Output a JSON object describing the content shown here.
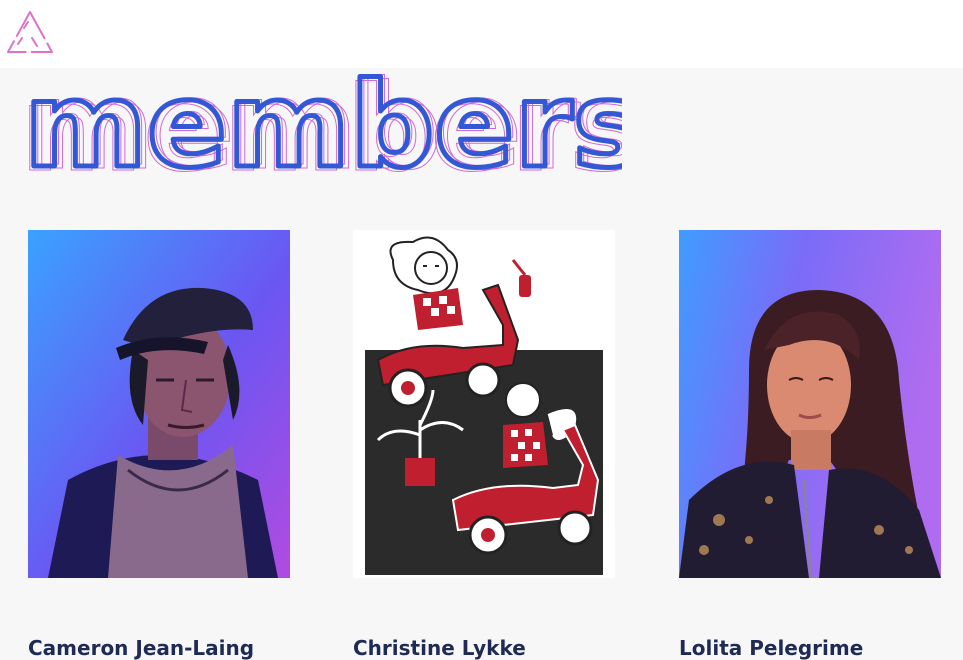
{
  "header": {
    "logo_icon": "triangle-outline-logo",
    "logo_color": "#e070c8"
  },
  "page": {
    "title": "members",
    "title_color": "#3358d6",
    "title_shadow_color": "#d46ad0",
    "background": "#f7f7f7"
  },
  "members": [
    {
      "name": "Cameron Jean-Laing",
      "photo": "portrait-man-cap-blue-purple-light"
    },
    {
      "name": "Christine Lykke",
      "photo": "illustration-two-figures-on-scooters"
    },
    {
      "name": "Lolita Pelegrime",
      "photo": "portrait-woman-blue-orange-light"
    }
  ],
  "colors": {
    "name_text": "#1f2a55",
    "illustration_red": "#c01f2f",
    "illustration_dark": "#2b2b2b"
  }
}
